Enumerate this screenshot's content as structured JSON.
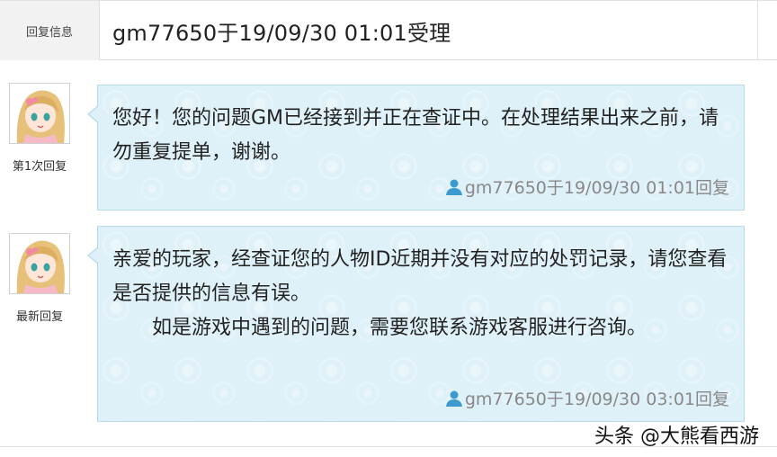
{
  "header": {
    "label": "回复信息",
    "value": "gm77650于19/09/30 01:01受理"
  },
  "replies": [
    {
      "label": "第1次回复",
      "paragraphs": [
        "您好！您的问题GM已经接到并正在查证中。在处理结果出来之前，请勿重复提单，谢谢。"
      ],
      "meta": "gm77650于19/09/30 01:01回复"
    },
    {
      "label": "最新回复",
      "paragraphs": [
        "亲爱的玩家，经查证您的人物ID近期并没有对应的处罚记录，请您查看是否提供的信息有误。",
        "如是游戏中遇到的问题，需要您联系游戏客服进行咨询。"
      ],
      "meta": "gm77650于19/09/30 03:01回复"
    }
  ],
  "watermark": "头条 @大熊看西游",
  "colors": {
    "bubble_bg": "#dff1f8",
    "bubble_border": "#b9dbe8",
    "header_label_bg": "#f2f2f2",
    "meta_text": "#888888",
    "user_icon": "#3b9bd0"
  },
  "icons": {
    "avatar": "anime-girl-avatar",
    "meta": "user-icon"
  }
}
